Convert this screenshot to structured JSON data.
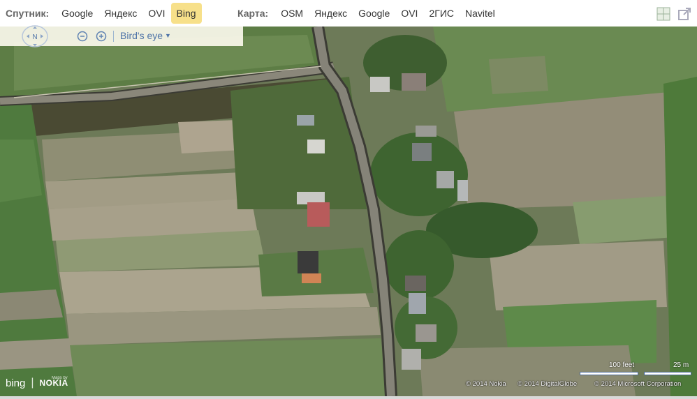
{
  "satellite": {
    "label": "Спутник:",
    "items": [
      "Google",
      "Яндекс",
      "OVI",
      "Bing"
    ],
    "active": "Bing"
  },
  "map_type": {
    "label": "Карта:",
    "items": [
      "OSM",
      "Яндекс",
      "Google",
      "OVI",
      "2ГИС",
      "Navitel"
    ]
  },
  "controls": {
    "compass_label": "N",
    "view_mode": "Bird's eye"
  },
  "scale": {
    "feet_label": "100 feet",
    "meters_label": "25 m"
  },
  "copyright": [
    "© 2014 Nokia",
    "© 2014 DigitalGlobe",
    "© 2014 Microsoft Corporation"
  ],
  "branding": {
    "logo": "bing",
    "maps_by": "Maps by",
    "partner": "NOKIA"
  },
  "icons": {
    "layers": "grid-layers-icon",
    "external": "external-link-icon"
  },
  "colors": {
    "active_tab": "#f7e08a",
    "link_blue": "#4f74a8"
  }
}
